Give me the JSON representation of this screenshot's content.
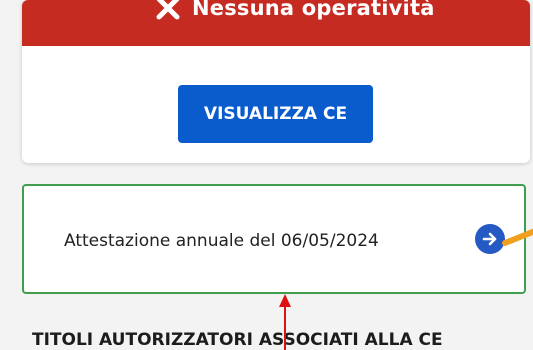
{
  "status_banner": {
    "text": "Nessuna operatività",
    "icon": "close-icon",
    "color": "#c62b22"
  },
  "visualizza_button": {
    "label": "VISUALIZZA CE",
    "color": "#0a5ccc"
  },
  "attestazione_card": {
    "label": "Attestazione annuale del 06/05/2024",
    "arrow_icon": "arrow-right-circle-icon",
    "border_color": "#3f9f4f"
  },
  "section": {
    "heading": "TITOLI AUTORIZZATORI ASSOCIATI ALLA CE"
  },
  "annotations": {
    "red_arrow_color": "#e01010",
    "orange_pointer_color": "#f0a01e"
  }
}
